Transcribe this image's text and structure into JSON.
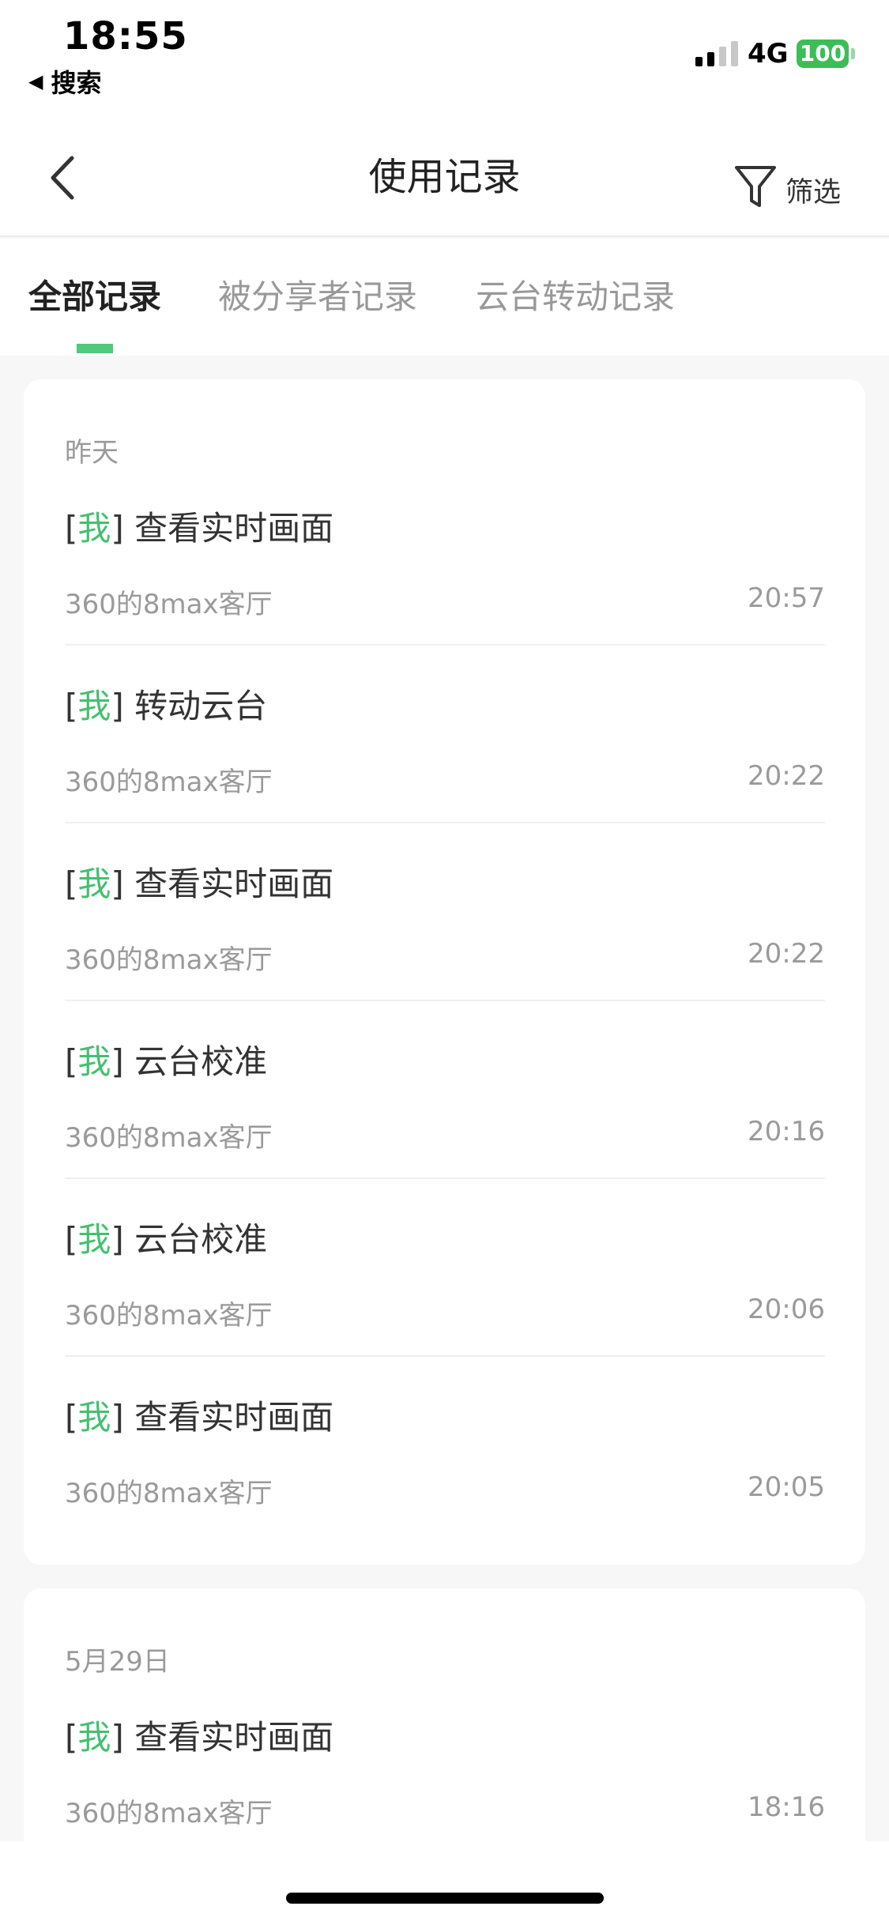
{
  "status_bar": {
    "time": "18:55",
    "back_app_label": "搜索",
    "network": "4G",
    "battery": "100",
    "battery_color": "#3cbd57"
  },
  "nav": {
    "title": "使用记录",
    "filter_label": "筛选"
  },
  "tabs": [
    {
      "label": "全部记录",
      "active": true
    },
    {
      "label": "被分享者记录",
      "active": false
    },
    {
      "label": "云台转动记录",
      "active": false
    }
  ],
  "accent_color": "#4fc97c",
  "groups": [
    {
      "date": "昨天",
      "records": [
        {
          "actor": "我",
          "action": "查看实时画面",
          "device": "360的8max客厅",
          "time": "20:57"
        },
        {
          "actor": "我",
          "action": "转动云台",
          "device": "360的8max客厅",
          "time": "20:22"
        },
        {
          "actor": "我",
          "action": "查看实时画面",
          "device": "360的8max客厅",
          "time": "20:22"
        },
        {
          "actor": "我",
          "action": "云台校准",
          "device": "360的8max客厅",
          "time": "20:16"
        },
        {
          "actor": "我",
          "action": "云台校准",
          "device": "360的8max客厅",
          "time": "20:06"
        },
        {
          "actor": "我",
          "action": "查看实时画面",
          "device": "360的8max客厅",
          "time": "20:05"
        }
      ]
    },
    {
      "date": "5月29日",
      "records": [
        {
          "actor": "我",
          "action": "查看实时画面",
          "device": "360的8max客厅",
          "time": "18:16"
        }
      ]
    }
  ]
}
